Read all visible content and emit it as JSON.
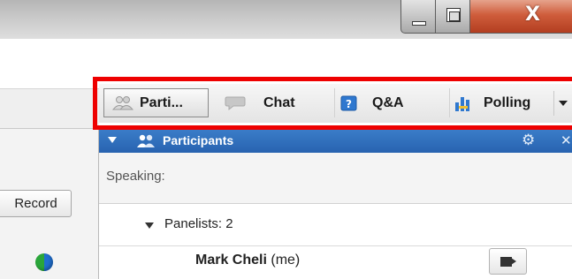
{
  "window": {
    "minimize_label": "minimize",
    "maximize_label": "maximize",
    "close_label": "X"
  },
  "toolbar": {
    "record_label": "Record"
  },
  "tabs": [
    {
      "label": "Parti...",
      "icon": "participants-icon",
      "active": true
    },
    {
      "label": "Chat",
      "icon": "chat-bubble-icon",
      "active": false
    },
    {
      "label": "Q&A",
      "icon": "help-icon",
      "active": false
    },
    {
      "label": "Polling",
      "icon": "polling-icon",
      "active": false
    }
  ],
  "participants_panel": {
    "title": "Participants",
    "speaking_label": "Speaking:",
    "panelists_label": "Panelists: 2",
    "users": [
      {
        "name": "Mark Cheli",
        "suffix": " (me)"
      }
    ]
  },
  "colors": {
    "highlight": "#ee0000",
    "panel_header": "#2d6bb8",
    "close_button": "#c8502f"
  }
}
